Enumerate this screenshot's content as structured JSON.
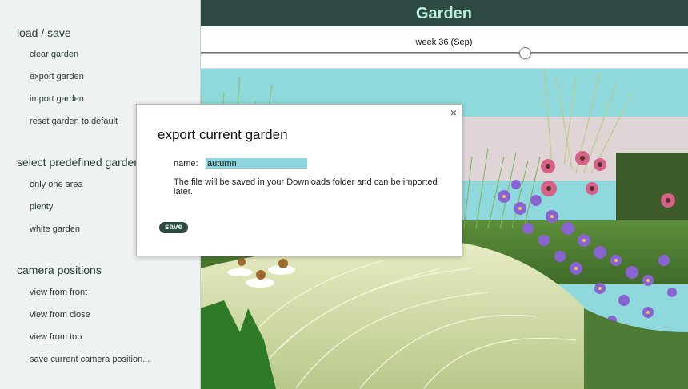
{
  "header": {
    "title": "Garden"
  },
  "timeline": {
    "week_label": "week 36 (Sep)"
  },
  "sidebar": {
    "load_save": {
      "title": "load / save",
      "items": [
        "clear garden",
        "export garden",
        "import garden",
        "reset garden to default"
      ]
    },
    "predefined": {
      "title": "select predefined garden",
      "items": [
        "only one area",
        "plenty",
        "white garden"
      ]
    },
    "camera": {
      "title": "camera positions",
      "items": [
        "view from front",
        "view from close",
        "view from top",
        "save current camera position..."
      ]
    }
  },
  "dialog": {
    "close_icon": "close-icon",
    "title": "export current garden",
    "name_label": "name:",
    "name_value": "autumn",
    "note": "The file will be saved in your Downloads folder and can be imported later.",
    "save_label": "save"
  },
  "colors": {
    "accent": "#2f4a44",
    "header_text": "#b9f0dc",
    "sidebar_bg": "#eef2f3",
    "sky": "#8fd9dc",
    "input_highlight": "#8ed4dc"
  }
}
